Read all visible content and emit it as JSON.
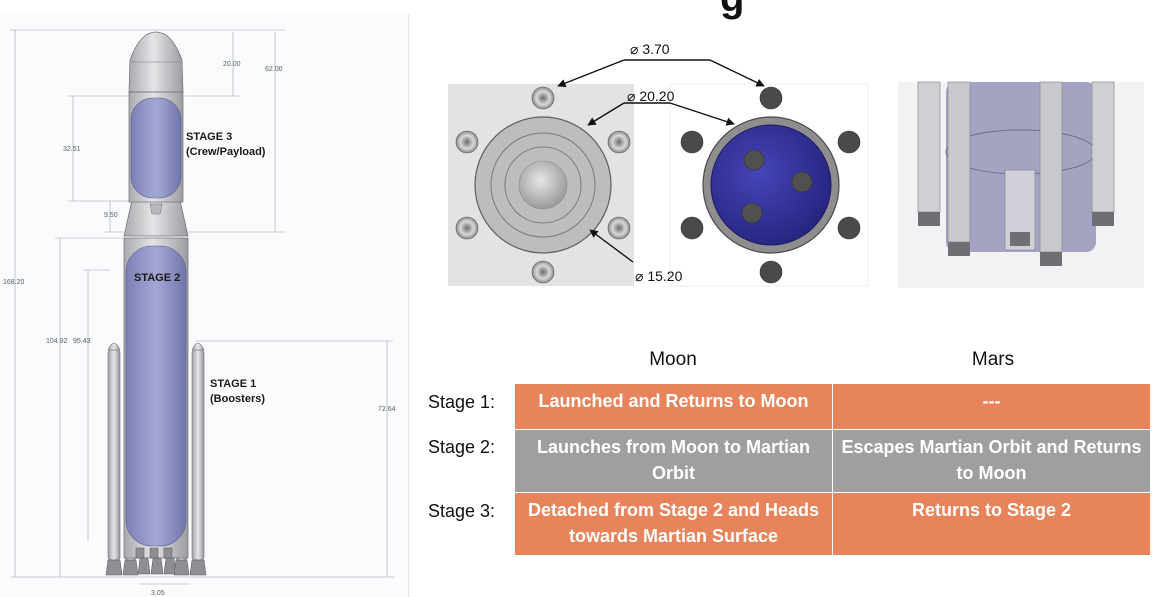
{
  "title_fragment": "g",
  "rocket_side_view": {
    "stage_labels": {
      "stage3": [
        "STAGE 3",
        "(Crew/Payload)"
      ],
      "stage2": "STAGE 2",
      "stage1": [
        "STAGE 1",
        "(Boosters)"
      ]
    },
    "dimensions": {
      "d_20_00": "20.00",
      "d_62_00": "62.00",
      "d_32_51": "32.51",
      "d_9_50": "9.50",
      "d_168_20": "168.20",
      "d_104_92": "104.92",
      "d_95_43": "95.43",
      "d_72_64": "72.64",
      "d_3_05": "3.05"
    }
  },
  "top_views": {
    "callouts": {
      "booster_diameter": "⌀ 3.70",
      "outer_diameter": "⌀ 20.20",
      "inner_diameter": "⌀ 15.20"
    }
  },
  "mission_table": {
    "columns": [
      "Moon",
      "Mars"
    ],
    "rows": [
      {
        "label": "Stage 1:",
        "moon": "Launched and Returns to Moon",
        "mars": "---",
        "moon_color": "#e8845c",
        "mars_color": "#e8845c"
      },
      {
        "label": "Stage 2:",
        "moon": "Launches from Moon to Martian Orbit",
        "mars": "Escapes Martian Orbit and Returns to Moon",
        "moon_color": "#a09f9e",
        "mars_color": "#a09f9e"
      },
      {
        "label": "Stage 3:",
        "moon": "Detached from Stage 2 and Heads towards Martian Surface",
        "mars": "Returns to Stage 2",
        "moon_color": "#e8845c",
        "mars_color": "#e8845c"
      }
    ]
  },
  "colors": {
    "orange_cell": "#e8845c",
    "grey_cell": "#a09f9e",
    "tank_purple": "#8c8fc4",
    "body_grey": "#c9cacd",
    "top_view_blue": "#2b2a8f"
  }
}
